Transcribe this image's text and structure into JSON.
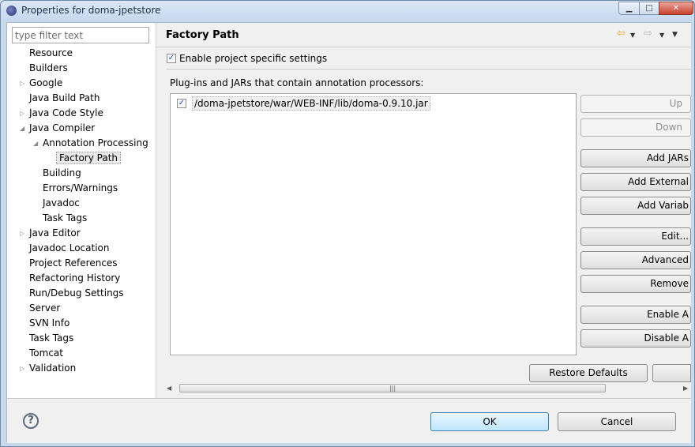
{
  "window": {
    "title": "Properties for doma-jpetstore",
    "min_glyph": "▁",
    "max_glyph": "□",
    "close_glyph": "✕"
  },
  "sidebar": {
    "filter_placeholder": "type filter text",
    "items": [
      {
        "label": "Resource",
        "depth": 0,
        "expander": ""
      },
      {
        "label": "Builders",
        "depth": 0,
        "expander": ""
      },
      {
        "label": "Google",
        "depth": 0,
        "expander": "▷"
      },
      {
        "label": "Java Build Path",
        "depth": 0,
        "expander": ""
      },
      {
        "label": "Java Code Style",
        "depth": 0,
        "expander": "▷"
      },
      {
        "label": "Java Compiler",
        "depth": 0,
        "expander": "◢"
      },
      {
        "label": "Annotation Processing",
        "depth": 1,
        "expander": "◢"
      },
      {
        "label": "Factory Path",
        "depth": 2,
        "expander": "",
        "selected": true
      },
      {
        "label": "Building",
        "depth": 1,
        "expander": ""
      },
      {
        "label": "Errors/Warnings",
        "depth": 1,
        "expander": ""
      },
      {
        "label": "Javadoc",
        "depth": 1,
        "expander": ""
      },
      {
        "label": "Task Tags",
        "depth": 1,
        "expander": ""
      },
      {
        "label": "Java Editor",
        "depth": 0,
        "expander": "▷"
      },
      {
        "label": "Javadoc Location",
        "depth": 0,
        "expander": ""
      },
      {
        "label": "Project References",
        "depth": 0,
        "expander": ""
      },
      {
        "label": "Refactoring History",
        "depth": 0,
        "expander": ""
      },
      {
        "label": "Run/Debug Settings",
        "depth": 0,
        "expander": ""
      },
      {
        "label": "Server",
        "depth": 0,
        "expander": ""
      },
      {
        "label": "SVN Info",
        "depth": 0,
        "expander": ""
      },
      {
        "label": "Task Tags",
        "depth": 0,
        "expander": ""
      },
      {
        "label": "Tomcat",
        "depth": 0,
        "expander": ""
      },
      {
        "label": "Validation",
        "depth": 0,
        "expander": "▷"
      }
    ]
  },
  "page": {
    "title": "Factory Path",
    "enable_label": "Enable project specific settings",
    "enable_checked": true,
    "section_label": "Plug-ins and JARs that contain annotation processors:",
    "entries": [
      {
        "path": "/doma-jpetstore/war/WEB-INF/lib/doma-0.9.10.jar",
        "checked": true
      }
    ],
    "buttons": {
      "up": "Up",
      "down": "Down",
      "add_jars": "Add JARs",
      "add_external": "Add External",
      "add_variable": "Add Variab",
      "edit": "Edit...",
      "advanced": "Advanced",
      "remove": "Remove",
      "enable_all": "Enable A",
      "disable_all": "Disable A"
    },
    "restore_defaults": "Restore Defaults",
    "apply": ""
  },
  "footer": {
    "help": "?",
    "ok": "OK",
    "cancel": "Cancel"
  },
  "colors": {
    "ok_border": "#3c7fb1",
    "checkmark": "#2b4f9b",
    "back_arrow": "#e8a91c"
  },
  "icons": {
    "nav_back": "arrow-left-icon",
    "nav_forward": "arrow-right-icon",
    "menu": "chevron-down-icon"
  }
}
